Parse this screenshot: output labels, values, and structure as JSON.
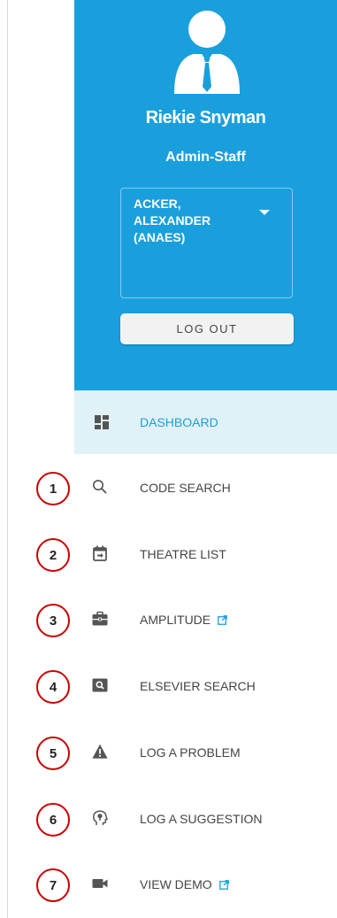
{
  "profile": {
    "name": "Riekie Snyman",
    "role": "Admin-Staff",
    "selected_provider": "ACKER, ALEXANDER (ANAES)",
    "logout_label": "LOG OUT",
    "background_color": "#1a9fdd"
  },
  "nav": {
    "dashboard": {
      "label": "DASHBOARD",
      "icon": "dashboard-icon"
    },
    "items": [
      {
        "number": "1",
        "label": "CODE SEARCH",
        "icon": "search-icon",
        "external": false
      },
      {
        "number": "2",
        "label": "THEATRE LIST",
        "icon": "calendar-icon",
        "external": false
      },
      {
        "number": "3",
        "label": "AMPLITUDE",
        "icon": "briefcase-icon",
        "external": true
      },
      {
        "number": "4",
        "label": "ELSEVIER SEARCH",
        "icon": "image-search-icon",
        "external": false
      },
      {
        "number": "5",
        "label": "LOG A PROBLEM",
        "icon": "warning-icon",
        "external": false
      },
      {
        "number": "6",
        "label": "LOG A SUGGESTION",
        "icon": "lightbulb-head-icon",
        "external": false
      },
      {
        "number": "7",
        "label": "VIEW DEMO",
        "icon": "video-camera-icon",
        "external": true
      }
    ]
  },
  "colors": {
    "accent": "#1a9fdd",
    "active_row": "#e1f1f8",
    "badge_ring": "#cc0000",
    "icon": "#555555"
  }
}
